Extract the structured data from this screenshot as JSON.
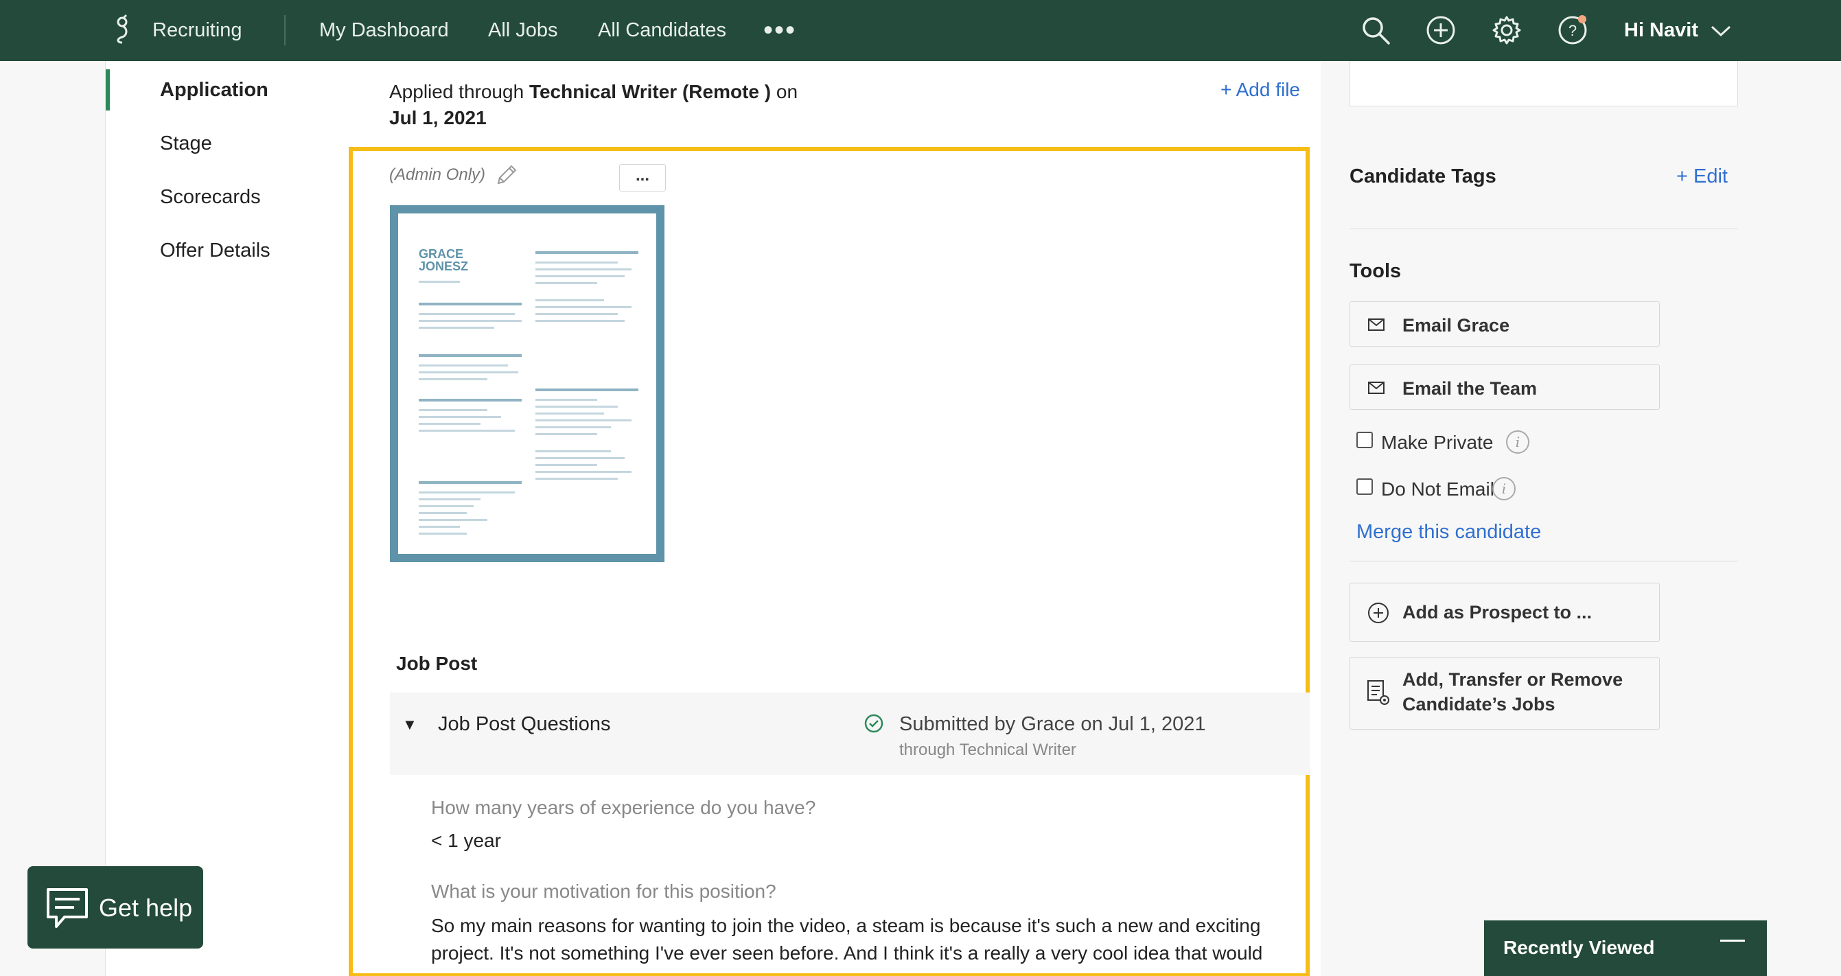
{
  "topnav": {
    "brand": "Recruiting",
    "links": [
      "My Dashboard",
      "All Jobs",
      "All Candidates"
    ],
    "more": "•••",
    "greeting": "Hi Navit",
    "icons": [
      "search-icon",
      "add-circle-icon",
      "gear-icon",
      "help-icon",
      "chevron-down-icon"
    ],
    "notification_color": "#f4a582"
  },
  "subnav": {
    "items": [
      "Application",
      "Stage",
      "Scorecards",
      "Offer Details"
    ],
    "active": "Application"
  },
  "application": {
    "applied_prefix": "Applied through ",
    "job_name": "Technical Writer (Remote )",
    "applied_suffix": " on",
    "date": "Jul 1, 2021",
    "add_file": "+ Add file",
    "admin_only": "(Admin Only)",
    "more_menu": "...",
    "resume": {
      "name_line1": "GRACE",
      "name_line2": "JONESZ"
    }
  },
  "job_post": {
    "title": "Job Post",
    "questions_label": "Job Post Questions",
    "submitted": "Submitted by Grace on Jul 1, 2021",
    "through": "through Technical Writer",
    "qa": [
      {
        "q": "How many years of experience do you have?",
        "a": "< 1 year"
      },
      {
        "q": "What is your motivation for this position?",
        "a": "So my main reasons for wanting to join the video, a steam is because it's such a new and exciting project. It's not something I've ever seen before. And I think it's a really a very cool idea that would"
      }
    ]
  },
  "right": {
    "tags_title": "Candidate Tags",
    "tags_edit": "+ Edit",
    "tools_title": "Tools",
    "email_candidate": "Email Grace",
    "email_team": "Email the Team",
    "make_private": "Make Private",
    "do_not_email": "Do Not Email",
    "info_glyph": "i",
    "merge": "Merge this candidate",
    "add_prospect": "Add as Prospect to ...",
    "transfer_line1": "Add, Transfer or Remove",
    "transfer_line2": "Candidate’s Jobs"
  },
  "recently_viewed": "Recently Viewed",
  "get_help": "Get help",
  "colors": {
    "nav": "#234a3a",
    "accent": "#2a8a5a",
    "link": "#2f6fd0",
    "highlight": "#f6bd16"
  }
}
